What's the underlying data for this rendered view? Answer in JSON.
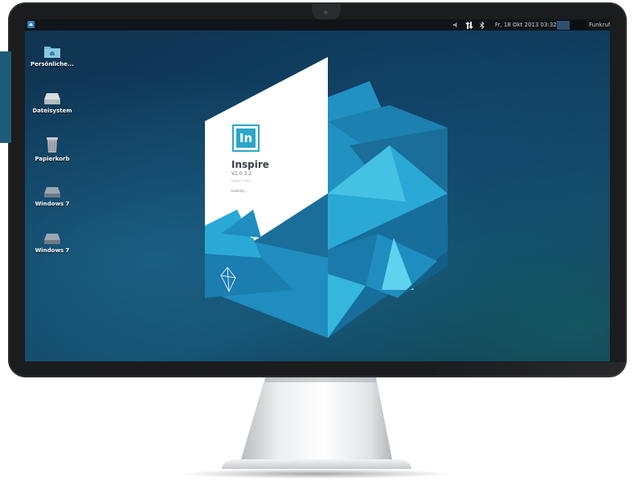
{
  "top_panel": {
    "clock": "Fr, 18 Okt 2013 03:32",
    "network_label": "Funkruf",
    "icons": [
      "volume-icon",
      "network-transfer-icon",
      "bluetooth-icon"
    ]
  },
  "desktop_icons": [
    {
      "name": "home-folder",
      "label": "Persönliche...",
      "icon": "folder-home-icon"
    },
    {
      "name": "filesystem",
      "label": "Dateisystem",
      "icon": "drive-icon"
    },
    {
      "name": "trash",
      "label": "Papierkorb",
      "icon": "trash-icon"
    },
    {
      "name": "windows7-a",
      "label": "Windows 7",
      "icon": "hard-disk-icon"
    },
    {
      "name": "windows7-b",
      "label": "Windows 7",
      "icon": "hard-disk-icon"
    }
  ],
  "splash": {
    "app_logo_text": "In",
    "app_name": "Inspire",
    "version": "V1.0.3.2",
    "copyright": "Images © 2013 ...",
    "status": "Loading ..."
  },
  "colors": {
    "accent": "#2aa6c9",
    "panel_bg": "#0f1418",
    "desktop_bg": "#0f3a5a",
    "monitor_bezel": "#1b1c1e"
  }
}
